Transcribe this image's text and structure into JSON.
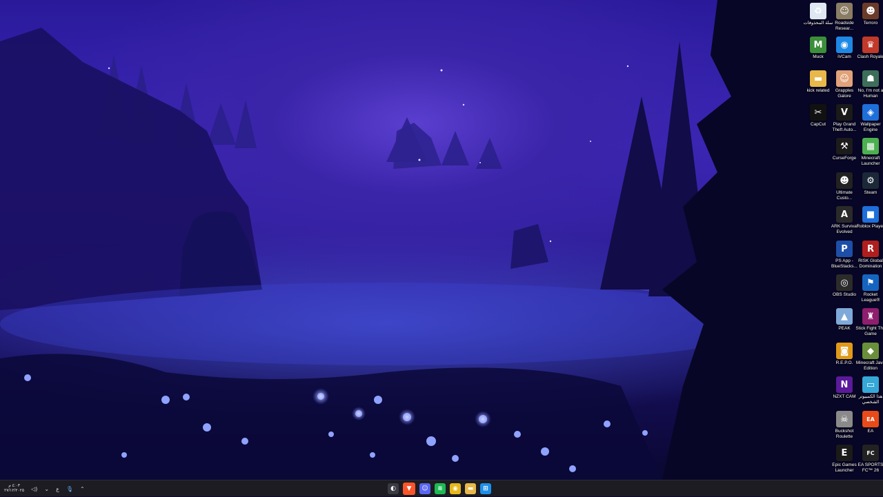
{
  "desktop_icons": [
    {
      "label": "سلة المحذوفات",
      "icon": "recycle-bin-icon",
      "color": "#dfe8f2",
      "glyph": "♻"
    },
    {
      "label": "Roadside Resear...",
      "icon": "roadside-research-icon",
      "color": "#8b7d64",
      "glyph": "☺"
    },
    {
      "label": "Terroro",
      "icon": "terroro-icon",
      "color": "#6b3b2a",
      "glyph": "☻"
    },
    {
      "label": "Muck",
      "icon": "muck-icon",
      "color": "#3b8e3a",
      "glyph": "M"
    },
    {
      "label": "iVCam",
      "icon": "ivcam-icon",
      "color": "#1e88e5",
      "glyph": "◉"
    },
    {
      "label": "Clash Royale",
      "icon": "clash-royale-icon",
      "color": "#c0392b",
      "glyph": "♛"
    },
    {
      "label": "kick related",
      "icon": "folder-icon",
      "color": "#e8b84a",
      "glyph": "▬"
    },
    {
      "label": "Grapples Galore",
      "icon": "grapples-galore-icon",
      "color": "#e0a27a",
      "glyph": "☺"
    },
    {
      "label": "No, I'm not a Human",
      "icon": "no-im-not-a-human-icon",
      "color": "#3d6e5a",
      "glyph": "☗"
    },
    {
      "label": "CapCut",
      "icon": "capcut-icon",
      "color": "#111111",
      "glyph": "✂"
    },
    {
      "label": "Play Grand Theft Auto...",
      "icon": "gta-icon",
      "color": "#1a1a1a",
      "glyph": "V"
    },
    {
      "label": "Wallpaper Engine",
      "icon": "wallpaper-engine-icon",
      "color": "#1e6fd9",
      "glyph": "◈"
    },
    {
      "label": "CurseForge",
      "icon": "curseforge-icon",
      "color": "#1c1c1c",
      "glyph": "⚒"
    },
    {
      "label": "Minecraft Launcher",
      "icon": "minecraft-launcher-icon",
      "color": "#4caf50",
      "glyph": "▦"
    },
    {
      "label": "Ultimate Custo...",
      "icon": "ultimate-custom-night-icon",
      "color": "#222222",
      "glyph": "☻"
    },
    {
      "label": "Steam",
      "icon": "steam-icon",
      "color": "#1b2838",
      "glyph": "⚙"
    },
    {
      "label": "ARK Survival Evolved",
      "icon": "ark-icon",
      "color": "#2a2a2a",
      "glyph": "A"
    },
    {
      "label": "Roblox Player",
      "icon": "roblox-icon",
      "color": "#1e6fd9",
      "glyph": "■"
    },
    {
      "label": "PS App - BlueStacks...",
      "icon": "ps-app-icon",
      "color": "#1e4fa8",
      "glyph": "P"
    },
    {
      "label": "RISK Global Domination",
      "icon": "risk-icon",
      "color": "#b01e1e",
      "glyph": "R"
    },
    {
      "label": "OBS Studio",
      "icon": "obs-studio-icon",
      "color": "#2b2b2b",
      "glyph": "◎"
    },
    {
      "label": "Rocket League®",
      "icon": "rocket-league-icon",
      "color": "#1565c0",
      "glyph": "⚑"
    },
    {
      "label": "PEAK",
      "icon": "peak-icon",
      "color": "#7fa9d8",
      "glyph": "▲"
    },
    {
      "label": "Stick Fight The Game",
      "icon": "stick-fight-icon",
      "color": "#8e1e6e",
      "glyph": "♜"
    },
    {
      "label": "R.E.P.O.",
      "icon": "repo-icon",
      "color": "#e09a1a",
      "glyph": "◙"
    },
    {
      "label": "Minecraft Java Edition",
      "icon": "minecraft-java-icon",
      "color": "#6a8f3a",
      "glyph": "◆"
    },
    {
      "label": "NZXT CAM",
      "icon": "nzxt-cam-icon",
      "color": "#5a1a9a",
      "glyph": "N"
    },
    {
      "label": "هذا الكمبيوتر الشخصي",
      "icon": "this-pc-icon",
      "color": "#35a8d8",
      "glyph": "▭"
    },
    {
      "label": "Buckshot Roulette",
      "icon": "buckshot-roulette-icon",
      "color": "#8a8a8a",
      "glyph": "☠"
    },
    {
      "label": "EA",
      "icon": "ea-icon",
      "color": "#e84a1a",
      "glyph": "EA"
    },
    {
      "label": "Epic Games Launcher",
      "icon": "epic-games-icon",
      "color": "#1a1a1a",
      "glyph": "E"
    },
    {
      "label": "EA SPORTS FC™ 26",
      "icon": "ea-sports-fc-icon",
      "color": "#222222",
      "glyph": "FC"
    }
  ],
  "taskbar": {
    "clock_time": "٤:٠٣ م",
    "clock_date": "٢٧/١٢/٢٠٢٥",
    "lang": "ع",
    "volume_icon": "speaker-icon",
    "mic_icon": "microphone-icon",
    "apps": [
      {
        "name": "browser-icon",
        "color": "#3a3a44",
        "glyph": "◐"
      },
      {
        "name": "brave-icon",
        "color": "#fb542b",
        "glyph": "▼",
        "active": true
      },
      {
        "name": "discord-icon",
        "color": "#5865f2",
        "glyph": "☺"
      },
      {
        "name": "spotify-icon",
        "color": "#1db954",
        "glyph": "≋"
      },
      {
        "name": "chrome-icon",
        "color": "#e8b71a",
        "glyph": "◉"
      },
      {
        "name": "file-explorer-icon",
        "color": "#e8b84a",
        "glyph": "▬"
      },
      {
        "name": "start-icon",
        "color": "#1e8fe8",
        "glyph": "⊞"
      }
    ]
  }
}
